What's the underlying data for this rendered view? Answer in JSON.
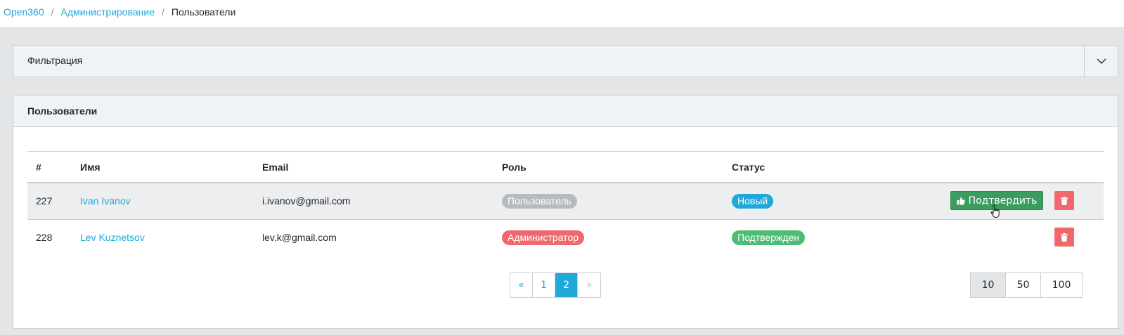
{
  "breadcrumb": {
    "items": [
      "Open360",
      "Администрирование",
      "Пользователи"
    ],
    "separator": "/"
  },
  "filter": {
    "title": "Фильтрация",
    "toggle_icon": "chevron-down-icon"
  },
  "users": {
    "title": "Пользователи",
    "columns": [
      "#",
      "Имя",
      "Email",
      "Роль",
      "Статус"
    ],
    "rows": [
      {
        "id": "227",
        "name": "Ivan Ivanov",
        "email": "i.ivanov@gmail.com",
        "role": "Пользователь",
        "status": "Новый",
        "confirm_label": "Подтвердить"
      },
      {
        "id": "228",
        "name": "Lev Kuznetsov",
        "email": "lev.k@gmail.com",
        "role": "Администратор",
        "status": "Подтвержден"
      }
    ]
  },
  "pagination": {
    "prev": "«",
    "pages": [
      "1",
      "2"
    ],
    "active_page": "2",
    "next": "»"
  },
  "page_size": {
    "options": [
      "10",
      "50",
      "100"
    ],
    "selected": "10"
  },
  "colors": {
    "link": "#20a8d8",
    "badge_user": "#b4bcc2",
    "badge_admin": "#f0686b",
    "badge_new": "#20a8d8",
    "badge_confirmed": "#4dbd74",
    "confirm_button": "#3a9d5d",
    "delete_button": "#f0686b"
  }
}
